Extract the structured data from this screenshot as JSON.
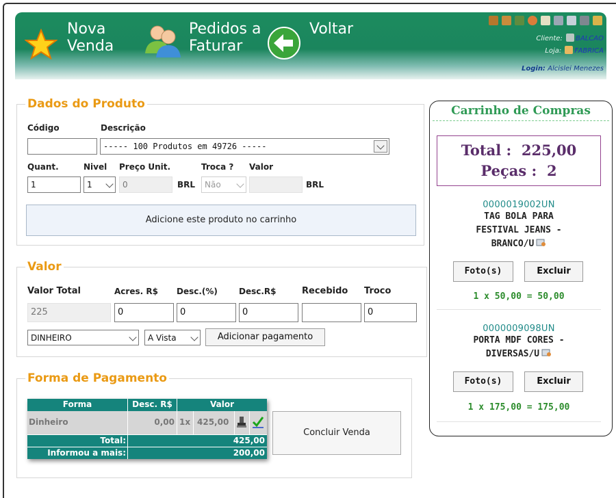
{
  "header": {
    "nav": [
      {
        "label_line1": "Nova",
        "label_line2": "Venda"
      },
      {
        "label_line1": "Pedidos a",
        "label_line2": "Faturar"
      },
      {
        "label_line1": "Voltar",
        "label_line2": ""
      }
    ],
    "toolbar_icons": [
      "box-icon",
      "package-icon",
      "cash-icon",
      "user-icon",
      "document-icon",
      "tools-icon",
      "calculator-icon",
      "printer-icon",
      "lock-icon"
    ],
    "cliente_label": "Cliente:",
    "cliente_value": "BALCAO",
    "loja_label": "Loja:",
    "loja_value": "FABRICA",
    "login_label": "Login:",
    "login_value": "Alcislei Menezes"
  },
  "produto": {
    "legend": "Dados do Produto",
    "codigo_label": "Código",
    "descricao_label": "Descrição",
    "codigo_value": "",
    "descricao_value": "----- 100 Produtos em 49726 -----",
    "quant_label": "Quant.",
    "nivel_label": "Nivel",
    "preco_label": "Preço Unit.",
    "troca_label": "Troca ?",
    "valor_label": "Valor",
    "quant_value": "1",
    "nivel_value": "1",
    "preco_value": "0",
    "currency": "BRL",
    "troca_value": "Não",
    "valor_value": "",
    "add_button": "Adicione este produto no carrinho"
  },
  "valor": {
    "legend": "Valor",
    "labels": {
      "total": "Valor Total",
      "acres": "Acres. R$",
      "desc_pct": "Desc.(%)",
      "desc_rs": "Desc.R$",
      "recebido": "Recebido",
      "troco": "Troco"
    },
    "values": {
      "total": "225",
      "acres": "0",
      "desc_pct": "0",
      "desc_rs": "0",
      "recebido": "",
      "troco": "0"
    },
    "metodo": "DINHEIRO",
    "condicao": "A Vista",
    "add_payment_button": "Adicionar pagamento"
  },
  "pagamento": {
    "legend": "Forma de Pagamento",
    "headers": {
      "forma": "Forma",
      "desc": "Desc. R$",
      "valor": "Valor"
    },
    "row": {
      "forma": "Dinheiro",
      "desc": "0,00",
      "qty": "1x",
      "valor": "425,00"
    },
    "total_label": "Total:",
    "total_value": "425,00",
    "informou_label": "Informou a mais:",
    "informou_value": "200,00",
    "concluir_button": "Concluir Venda"
  },
  "carrinho": {
    "title": "Carrinho de Compras",
    "total_label": "Total :",
    "total_value": "225,00",
    "pecas_label": "Peças :",
    "pecas_value": "2",
    "foto_button": "Foto(s)",
    "excluir_button": "Excluir",
    "items": [
      {
        "code": "0000019002UN",
        "name_lines": [
          "TAG BOLA PARA",
          "FESTIVAL JEANS -",
          "BRANCO/U"
        ],
        "summary": "1 x 50,00 = 50,00"
      },
      {
        "code": "0000009098UN",
        "name_lines": [
          "PORTA MDF CORES -",
          "DIVERSAS/U"
        ],
        "summary": "1 x 175,00 = 175,00"
      }
    ]
  },
  "colors": {
    "header_green": "#1c8c5f",
    "legend_orange": "#ea9a14",
    "table_teal": "#15847c",
    "cart_green": "#2f9a55",
    "total_purple": "#5a2d6a"
  }
}
